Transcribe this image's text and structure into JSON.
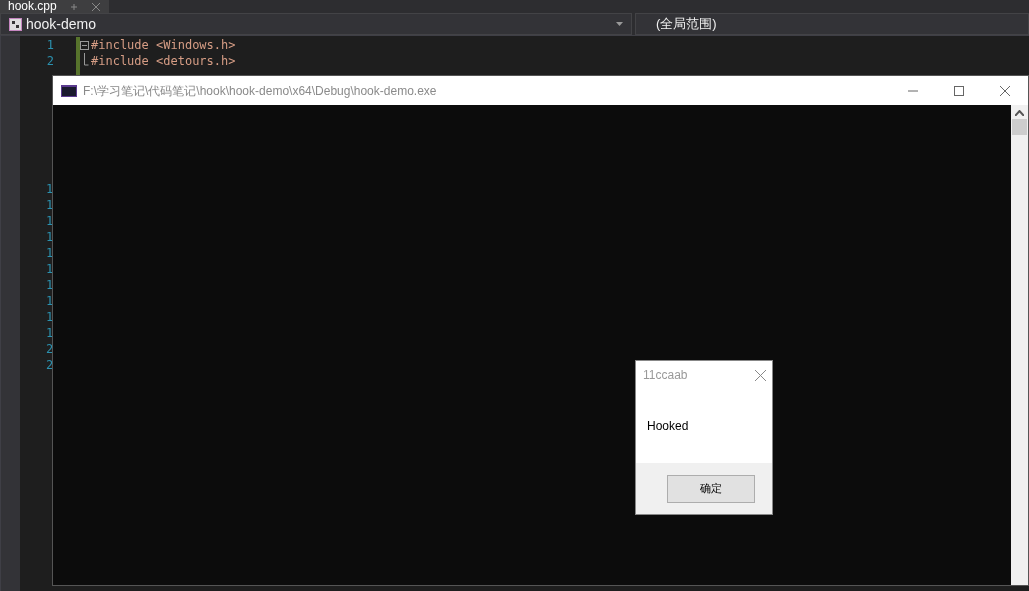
{
  "editor_tab": {
    "label": "hook.cpp",
    "selected": true
  },
  "nav_bar": {
    "project": "hook-demo",
    "scope": "(全局范围)"
  },
  "code_lines": [
    {
      "number": "1",
      "code": "#include <Windows.h>",
      "fold_start": true
    },
    {
      "number": "2",
      "code": "#include <detours.h>",
      "fold_start": false
    }
  ],
  "partial_line_numbers": [
    "1",
    "1",
    "1",
    "1",
    "1",
    "1",
    "1",
    "1",
    "1",
    "1",
    "2",
    "2"
  ],
  "console_window": {
    "title": "F:\\学习笔记\\代码笔记\\hook\\hook-demo\\x64\\Debug\\hook-demo.exe"
  },
  "message_box": {
    "title": "11ccaab",
    "message": "Hooked",
    "button": "确定"
  }
}
